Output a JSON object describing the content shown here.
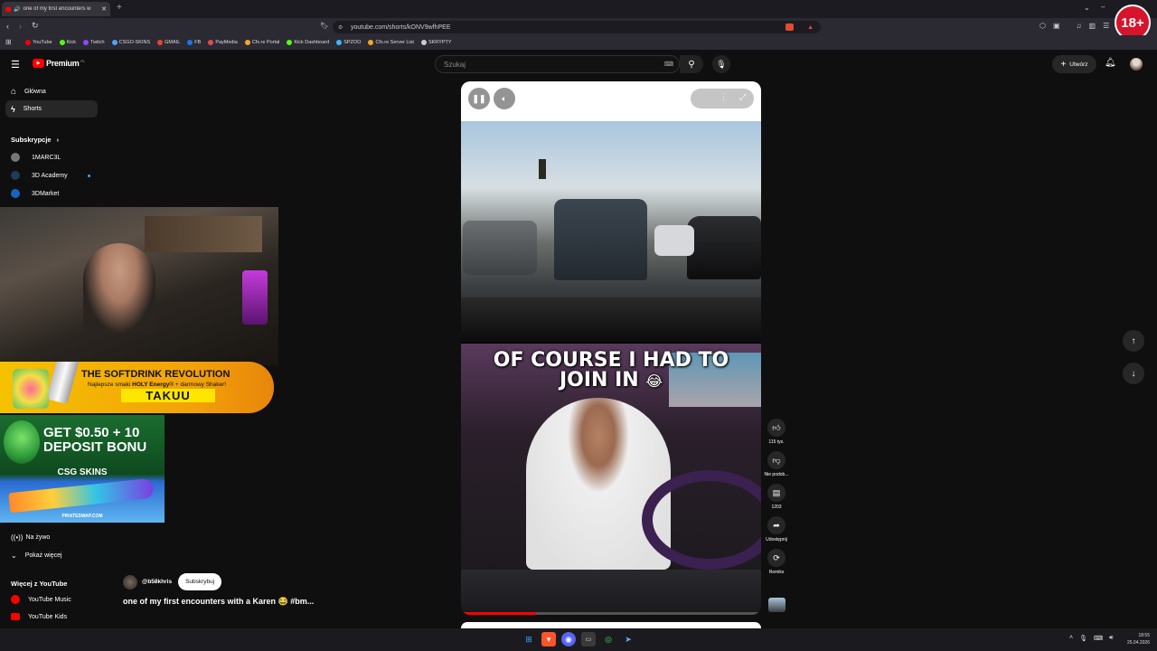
{
  "browser": {
    "tab_title": "one of my first encounters w",
    "url": "youtube.com/shorts/kONV9wfhPEE",
    "bookmarks": [
      {
        "label": "YouTube",
        "color": "#ff0000"
      },
      {
        "label": "Kick",
        "color": "#53fc18"
      },
      {
        "label": "Twitch",
        "color": "#9146ff"
      },
      {
        "label": "CSGO-SKINS",
        "color": "#4aa3ff"
      },
      {
        "label": "GMAIL",
        "color": "#ea4335"
      },
      {
        "label": "FB",
        "color": "#1877f2"
      },
      {
        "label": "PayMedia",
        "color": "#e5484d"
      },
      {
        "label": "Cfx.re Portal",
        "color": "#f5a623"
      },
      {
        "label": "Kick Dashboard",
        "color": "#53fc18"
      },
      {
        "label": "SPZOO",
        "color": "#38b6ff"
      },
      {
        "label": "Cfx.re Server List",
        "color": "#f5a623"
      },
      {
        "label": "SKRYPTY",
        "color": "#cccccc"
      }
    ],
    "age_badge": "18+"
  },
  "youtube": {
    "logo_text": "Premium",
    "logo_region": "PL",
    "search_placeholder": "Szukaj",
    "create_label": "Utwórz"
  },
  "sidebar": {
    "nav": [
      {
        "label": "Główna",
        "icon": "home-icon"
      },
      {
        "label": "Shorts",
        "icon": "shorts-icon"
      }
    ],
    "subs_heading": "Subskrypcje",
    "subs": [
      {
        "label": "1MARC3L"
      },
      {
        "label": "3D Academy"
      },
      {
        "label": "3DMarket"
      }
    ],
    "live_label": "Na żywo",
    "more_label": "Pokaż więcej",
    "more_yt_heading": "Więcej z YouTube",
    "more_yt": [
      {
        "label": "YouTube Music"
      },
      {
        "label": "YouTube Kids"
      }
    ]
  },
  "overlay": {
    "banner_a_title": "THE SOFTDRINK REVOLUTION",
    "banner_a_sub_pre": "Najlepsze smaki ",
    "banner_a_sub_bold": "HOLY Energy",
    "banner_a_sub_post": "® + darmowy Shaker!",
    "banner_a_code": "TAKUU",
    "banner_b_line1": "GET $0.50 + 10",
    "banner_b_line2": "DEPOSIT BONU",
    "banner_b_brand": "CSG SKINS",
    "banner_b_footer": "PIRATESWAP.COM"
  },
  "short": {
    "caption_line1": "OF COURSE I HAD TO",
    "caption_line2": "JOIN IN",
    "caption_emoji": "😂",
    "channel": "@b58khris",
    "subscribe_label": "Subskrybuj",
    "title": "one of my first encounters with a Karen 😂 #bm...",
    "progress": 0.25,
    "actions": [
      {
        "label": "115 tys.",
        "icon": "like-icon"
      },
      {
        "label": "Nie podob...",
        "icon": "dislike-icon"
      },
      {
        "label": "1203",
        "icon": "comment-icon"
      },
      {
        "label": "Udostępnij",
        "icon": "share-icon"
      },
      {
        "label": "Remiks",
        "icon": "remix-icon"
      }
    ]
  },
  "taskbar": {
    "time": "18:55",
    "date": "25.04.2026"
  }
}
